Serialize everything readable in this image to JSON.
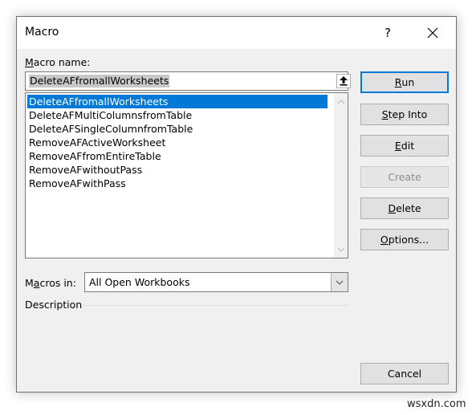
{
  "window": {
    "title": "Macro",
    "help_label": "?",
    "close_icon": "close-icon"
  },
  "macro_name": {
    "label_prefix": "",
    "label_mnemonic": "M",
    "label_rest": "acro name:",
    "value": "DeleteAFfromallWorksheets",
    "upload_icon": "upload-arrow-icon"
  },
  "macro_list": {
    "selected_index": 0,
    "items": [
      "DeleteAFfromallWorksheets",
      "DeleteAFMultiColumnsfromTable",
      "DeleteAFSingleColumnfromTable",
      "RemoveAFActiveWorksheet",
      "RemoveAFfromEntireTable",
      "RemoveAFwithoutPass",
      "RemoveAFwithPass"
    ]
  },
  "buttons": {
    "run": {
      "mnemonic": "R",
      "rest": "un"
    },
    "step_into": {
      "mnemonic": "S",
      "rest": "tep Into"
    },
    "edit": {
      "mnemonic": "E",
      "rest": "dit"
    },
    "create": {
      "label": "Create"
    },
    "delete": {
      "mnemonic": "D",
      "rest": "elete"
    },
    "options": {
      "mnemonic": "O",
      "rest": "ptions..."
    },
    "cancel": {
      "label": "Cancel"
    }
  },
  "macros_in": {
    "label_pre": "M",
    "label_mnemonic": "a",
    "label_rest": "cros in:",
    "value": "All Open Workbooks"
  },
  "description": {
    "label": "Description",
    "text": ""
  },
  "watermark": "wsxdn.com",
  "colors": {
    "accent": "#0078d7",
    "dialog_bg": "#f0f0f0",
    "button_bg": "#e1e1e1"
  }
}
